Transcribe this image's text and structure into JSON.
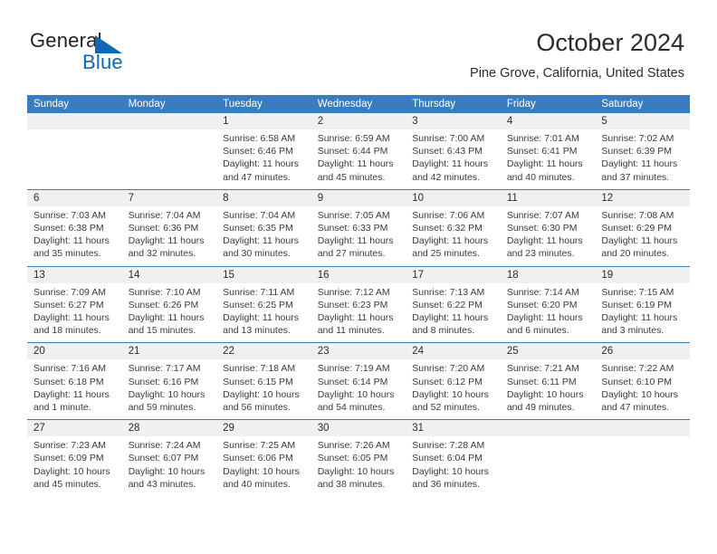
{
  "logo": {
    "word1": "General",
    "word2": "Blue",
    "icon": "flag-triangle-icon",
    "color_primary": "#1267b2",
    "color_text": "#231f20"
  },
  "header": {
    "month_title": "October 2024",
    "location": "Pine Grove, California, United States"
  },
  "theme": {
    "header_blue": "#3a7cc0",
    "daynum_bg": "#f0f0f0",
    "cell_bg": "#ffffff",
    "text": "#2b2b2b"
  },
  "calendar": {
    "day_headers": [
      "Sunday",
      "Monday",
      "Tuesday",
      "Wednesday",
      "Thursday",
      "Friday",
      "Saturday"
    ],
    "weeks": [
      {
        "days": [
          {
            "num": "",
            "lines": []
          },
          {
            "num": "",
            "lines": []
          },
          {
            "num": "1",
            "lines": [
              "Sunrise: 6:58 AM",
              "Sunset: 6:46 PM",
              "Daylight: 11 hours",
              "and 47 minutes."
            ]
          },
          {
            "num": "2",
            "lines": [
              "Sunrise: 6:59 AM",
              "Sunset: 6:44 PM",
              "Daylight: 11 hours",
              "and 45 minutes."
            ]
          },
          {
            "num": "3",
            "lines": [
              "Sunrise: 7:00 AM",
              "Sunset: 6:43 PM",
              "Daylight: 11 hours",
              "and 42 minutes."
            ]
          },
          {
            "num": "4",
            "lines": [
              "Sunrise: 7:01 AM",
              "Sunset: 6:41 PM",
              "Daylight: 11 hours",
              "and 40 minutes."
            ]
          },
          {
            "num": "5",
            "lines": [
              "Sunrise: 7:02 AM",
              "Sunset: 6:39 PM",
              "Daylight: 11 hours",
              "and 37 minutes."
            ]
          }
        ]
      },
      {
        "days": [
          {
            "num": "6",
            "lines": [
              "Sunrise: 7:03 AM",
              "Sunset: 6:38 PM",
              "Daylight: 11 hours",
              "and 35 minutes."
            ]
          },
          {
            "num": "7",
            "lines": [
              "Sunrise: 7:04 AM",
              "Sunset: 6:36 PM",
              "Daylight: 11 hours",
              "and 32 minutes."
            ]
          },
          {
            "num": "8",
            "lines": [
              "Sunrise: 7:04 AM",
              "Sunset: 6:35 PM",
              "Daylight: 11 hours",
              "and 30 minutes."
            ]
          },
          {
            "num": "9",
            "lines": [
              "Sunrise: 7:05 AM",
              "Sunset: 6:33 PM",
              "Daylight: 11 hours",
              "and 27 minutes."
            ]
          },
          {
            "num": "10",
            "lines": [
              "Sunrise: 7:06 AM",
              "Sunset: 6:32 PM",
              "Daylight: 11 hours",
              "and 25 minutes."
            ]
          },
          {
            "num": "11",
            "lines": [
              "Sunrise: 7:07 AM",
              "Sunset: 6:30 PM",
              "Daylight: 11 hours",
              "and 23 minutes."
            ]
          },
          {
            "num": "12",
            "lines": [
              "Sunrise: 7:08 AM",
              "Sunset: 6:29 PM",
              "Daylight: 11 hours",
              "and 20 minutes."
            ]
          }
        ]
      },
      {
        "days": [
          {
            "num": "13",
            "lines": [
              "Sunrise: 7:09 AM",
              "Sunset: 6:27 PM",
              "Daylight: 11 hours",
              "and 18 minutes."
            ]
          },
          {
            "num": "14",
            "lines": [
              "Sunrise: 7:10 AM",
              "Sunset: 6:26 PM",
              "Daylight: 11 hours",
              "and 15 minutes."
            ]
          },
          {
            "num": "15",
            "lines": [
              "Sunrise: 7:11 AM",
              "Sunset: 6:25 PM",
              "Daylight: 11 hours",
              "and 13 minutes."
            ]
          },
          {
            "num": "16",
            "lines": [
              "Sunrise: 7:12 AM",
              "Sunset: 6:23 PM",
              "Daylight: 11 hours",
              "and 11 minutes."
            ]
          },
          {
            "num": "17",
            "lines": [
              "Sunrise: 7:13 AM",
              "Sunset: 6:22 PM",
              "Daylight: 11 hours",
              "and 8 minutes."
            ]
          },
          {
            "num": "18",
            "lines": [
              "Sunrise: 7:14 AM",
              "Sunset: 6:20 PM",
              "Daylight: 11 hours",
              "and 6 minutes."
            ]
          },
          {
            "num": "19",
            "lines": [
              "Sunrise: 7:15 AM",
              "Sunset: 6:19 PM",
              "Daylight: 11 hours",
              "and 3 minutes."
            ]
          }
        ]
      },
      {
        "days": [
          {
            "num": "20",
            "lines": [
              "Sunrise: 7:16 AM",
              "Sunset: 6:18 PM",
              "Daylight: 11 hours",
              "and 1 minute."
            ]
          },
          {
            "num": "21",
            "lines": [
              "Sunrise: 7:17 AM",
              "Sunset: 6:16 PM",
              "Daylight: 10 hours",
              "and 59 minutes."
            ]
          },
          {
            "num": "22",
            "lines": [
              "Sunrise: 7:18 AM",
              "Sunset: 6:15 PM",
              "Daylight: 10 hours",
              "and 56 minutes."
            ]
          },
          {
            "num": "23",
            "lines": [
              "Sunrise: 7:19 AM",
              "Sunset: 6:14 PM",
              "Daylight: 10 hours",
              "and 54 minutes."
            ]
          },
          {
            "num": "24",
            "lines": [
              "Sunrise: 7:20 AM",
              "Sunset: 6:12 PM",
              "Daylight: 10 hours",
              "and 52 minutes."
            ]
          },
          {
            "num": "25",
            "lines": [
              "Sunrise: 7:21 AM",
              "Sunset: 6:11 PM",
              "Daylight: 10 hours",
              "and 49 minutes."
            ]
          },
          {
            "num": "26",
            "lines": [
              "Sunrise: 7:22 AM",
              "Sunset: 6:10 PM",
              "Daylight: 10 hours",
              "and 47 minutes."
            ]
          }
        ]
      },
      {
        "days": [
          {
            "num": "27",
            "lines": [
              "Sunrise: 7:23 AM",
              "Sunset: 6:09 PM",
              "Daylight: 10 hours",
              "and 45 minutes."
            ]
          },
          {
            "num": "28",
            "lines": [
              "Sunrise: 7:24 AM",
              "Sunset: 6:07 PM",
              "Daylight: 10 hours",
              "and 43 minutes."
            ]
          },
          {
            "num": "29",
            "lines": [
              "Sunrise: 7:25 AM",
              "Sunset: 6:06 PM",
              "Daylight: 10 hours",
              "and 40 minutes."
            ]
          },
          {
            "num": "30",
            "lines": [
              "Sunrise: 7:26 AM",
              "Sunset: 6:05 PM",
              "Daylight: 10 hours",
              "and 38 minutes."
            ]
          },
          {
            "num": "31",
            "lines": [
              "Sunrise: 7:28 AM",
              "Sunset: 6:04 PM",
              "Daylight: 10 hours",
              "and 36 minutes."
            ]
          },
          {
            "num": "",
            "lines": []
          },
          {
            "num": "",
            "lines": []
          }
        ]
      }
    ]
  }
}
